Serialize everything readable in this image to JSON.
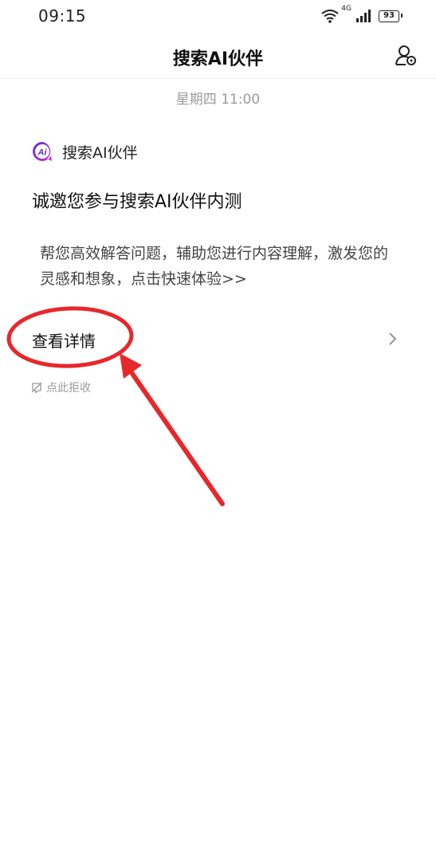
{
  "status_bar": {
    "time": "09:15",
    "network": "4G",
    "battery": "93"
  },
  "header": {
    "title": "搜索AI伙伴"
  },
  "message": {
    "timestamp": "星期四 11:00",
    "sender": "搜索AI伙伴",
    "title": "诚邀您参与搜索AI伙伴内测",
    "body": "帮您高效解答问题，辅助您进行内容理解，激发您的灵感和想象，点击快速体验>>",
    "detail_link": "查看详情",
    "reject_label": "点此拒收"
  },
  "icons": {
    "wifi": "wifi-icon",
    "signal": "signal-icon",
    "battery": "battery-icon",
    "settings": "user-settings-icon",
    "ai": "ai-badge-icon",
    "chevron": "chevron-right-icon",
    "reject": "reject-icon"
  },
  "colors": {
    "annotation_red": "#e8272b",
    "ai_badge_gradient_start": "#5a2bd6",
    "ai_badge_gradient_end": "#c637d6",
    "muted_text": "#9a9a9a"
  }
}
